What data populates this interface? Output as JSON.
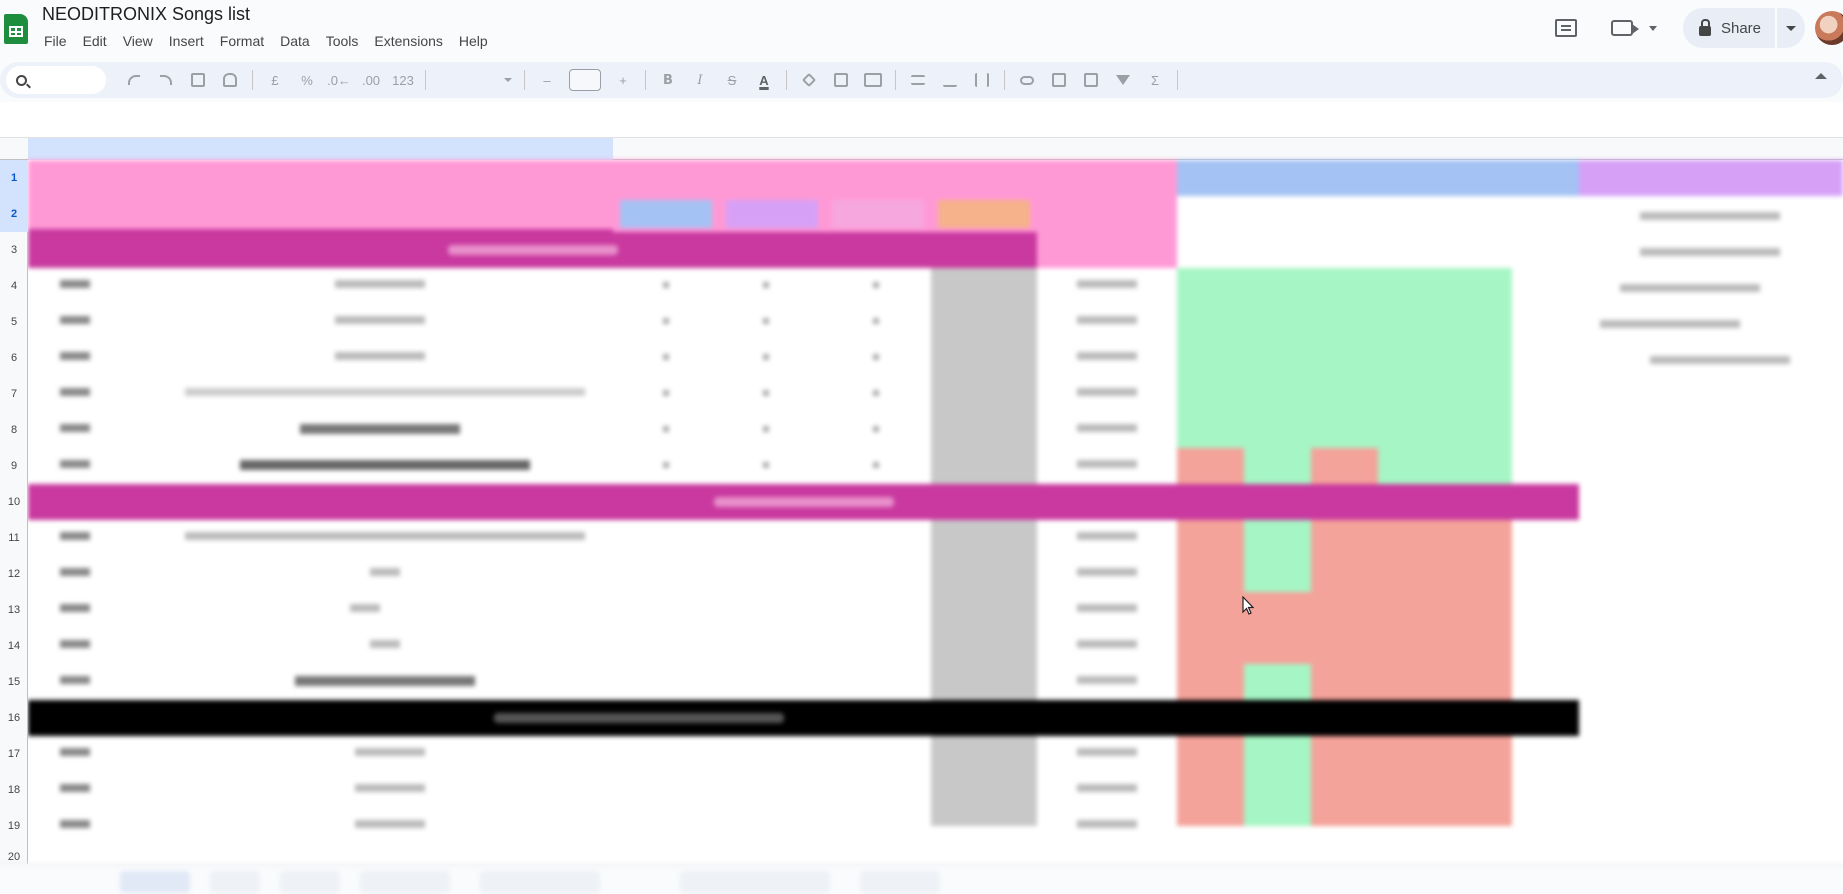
{
  "app": {
    "title": "NEODITRONIX Songs list"
  },
  "menu": [
    "File",
    "Edit",
    "View",
    "Insert",
    "Format",
    "Data",
    "Tools",
    "Extensions",
    "Help"
  ],
  "share": {
    "label": "Share"
  },
  "toolbar": {
    "currency": "£",
    "percent": "%",
    "dec_less": ".0←",
    "dec_more": ".00",
    "number_format": "123",
    "minus": "–",
    "plus": "+",
    "bold": "B",
    "italic": "I",
    "strike": "S",
    "text_color": "A",
    "sum": "Σ"
  },
  "rows": [
    "1",
    "2",
    "3",
    "4",
    "5",
    "6",
    "7",
    "8",
    "9",
    "10",
    "11",
    "12",
    "13",
    "14",
    "15",
    "16",
    "17",
    "18",
    "19",
    "20"
  ],
  "colors": {
    "pink": "#ff99d6",
    "magenta": "#c9399f",
    "blue_header": "#a4c2f4",
    "purple_header": "#d7a0f7",
    "green": "#a6f5c4",
    "red": "#f4a39a",
    "gray": "#c8c8c8",
    "black": "#000000"
  }
}
